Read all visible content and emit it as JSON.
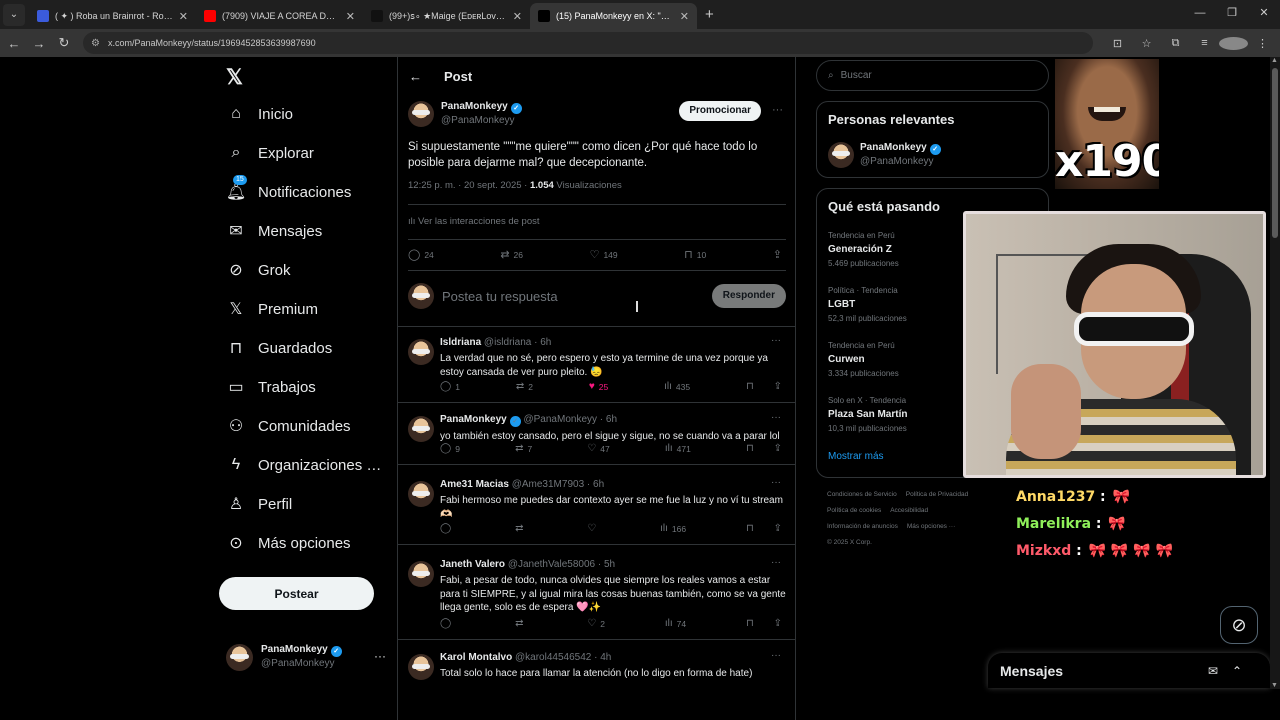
{
  "browser": {
    "tabs": [
      {
        "title": "( ✦ ) Roba un Brainrot - Roblox",
        "favicon": "roblox-icon",
        "color": "#3b5bdb",
        "active": false
      },
      {
        "title": "(7909) VIAJE A COREA DEL SUR",
        "favicon": "youtube-icon",
        "color": "#ff0000",
        "active": false
      },
      {
        "title": "(99+)ꜱ∘ ★Maiɡe (EᴅᴇʀLovᴇs) ♦",
        "favicon": "tiktok-icon",
        "color": "#111111",
        "active": false
      },
      {
        "title": "(15) PanaMonkeyy en X: \"Si sup",
        "favicon": "x-icon",
        "color": "#000000",
        "active": true
      }
    ],
    "url": "x.com/PanaMonkeyy/status/1969452853639987690"
  },
  "sidebar": {
    "logo": "𝕏",
    "items": [
      {
        "label": "Inicio",
        "icon": "home-icon",
        "glyph": "⌂"
      },
      {
        "label": "Explorar",
        "icon": "search-icon",
        "glyph": "⌕"
      },
      {
        "label": "Notificaciones",
        "icon": "bell-icon",
        "glyph": "🔔︎",
        "badge": "15"
      },
      {
        "label": "Mensajes",
        "icon": "mail-icon",
        "glyph": "✉"
      },
      {
        "label": "Grok",
        "icon": "grok-icon",
        "glyph": "⊘"
      },
      {
        "label": "Premium",
        "icon": "x-premium-icon",
        "glyph": "𝕏"
      },
      {
        "label": "Guardados",
        "icon": "bookmark-icon",
        "glyph": "⊓"
      },
      {
        "label": "Trabajos",
        "icon": "briefcase-icon",
        "glyph": "▭"
      },
      {
        "label": "Comunidades",
        "icon": "communities-icon",
        "glyph": "⚇"
      },
      {
        "label": "Organizaciones v...",
        "icon": "lightning-icon",
        "glyph": "ϟ"
      },
      {
        "label": "Perfil",
        "icon": "person-icon",
        "glyph": "♙"
      },
      {
        "label": "Más opciones",
        "icon": "more-circle-icon",
        "glyph": "⊙"
      }
    ],
    "post_button": "Postear",
    "account": {
      "name": "PanaMonkeyy",
      "handle": "@PanaMonkeyy"
    }
  },
  "main": {
    "header_title": "Post",
    "post": {
      "name": "PanaMonkeyy",
      "handle": "@PanaMonkeyy",
      "promote_label": "Promocionar",
      "text": "Si supuestamente \"\"\"me quiere\"\"\" como dicen ¿Por qué hace todo lo posible para dejarme mal? que decepcionante.",
      "time": "12:25 p. m. · 20 sept. 2025 · ",
      "views_count": "1.054",
      "views_label": " Visualizaciones",
      "interactions_link": "Ver las interacciones de post",
      "replies": "24",
      "reposts": "26",
      "likes": "149",
      "bookmarks": "10"
    },
    "composer": {
      "placeholder": "Postea tu respuesta",
      "reply_button": "Responder"
    },
    "replies": [
      {
        "name": "Isldriana",
        "handle": "@isldriana · 6h",
        "text": "La verdad que no sé, pero espero y esto ya termine de una vez porque ya estoy cansada de ver puro pleito. 😓",
        "replies": "1",
        "reposts": "2",
        "likes": "25",
        "views": "435",
        "liked": true,
        "verified": false
      },
      {
        "name": "PanaMonkeyy",
        "handle": "@PanaMonkeyy · 6h",
        "text": "yo también estoy cansado, pero el sigue y sigue, no se cuando va a parar lol",
        "replies": "9",
        "reposts": "7",
        "likes": "47",
        "views": "471",
        "liked": false,
        "verified": true
      },
      {
        "name": "Ame31 Macias",
        "handle": "@Ame31M7903 · 6h",
        "text": "Fabi hermoso me puedes dar contexto ayer se me fue la luz y no ví tu stream 🫶🏻",
        "replies": "",
        "reposts": "",
        "likes": "",
        "views": "166",
        "liked": false,
        "verified": false
      },
      {
        "name": "Janeth Valero",
        "handle": "@JanethVale58006 · 5h",
        "text": "Fabi, a pesar de todo, nunca olvides que siempre los reales vamos a estar para ti SIEMPRE, y al igual mira las cosas buenas también, como se va gente llega gente, solo es de espera 🩷✨",
        "replies": "",
        "reposts": "",
        "likes": "2",
        "views": "74",
        "liked": false,
        "verified": false
      },
      {
        "name": "Karol Montalvo",
        "handle": "@karol44546542 · 4h",
        "text": "Total solo lo hace para llamar la atención (no lo digo en forma de hate)",
        "replies": "",
        "reposts": "",
        "likes": "",
        "views": "",
        "liked": false,
        "verified": false
      }
    ]
  },
  "right": {
    "search_placeholder": "Buscar",
    "relevant_title": "Personas relevantes",
    "relevant": {
      "name": "PanaMonkeyy",
      "handle": "@PanaMonkeyy"
    },
    "trends_title": "Qué está pasando",
    "trends": [
      {
        "context": "Tendencia en Perú",
        "name": "Generación Z",
        "posts": "5.469 publicaciones"
      },
      {
        "context": "Política · Tendencia",
        "name": "LGBT",
        "posts": "52,3 mil publicaciones"
      },
      {
        "context": "Tendencia en Perú",
        "name": "Curwen",
        "posts": "3.334 publicaciones"
      },
      {
        "context": "Solo en X · Tendencia",
        "name": "Plaza San Martín",
        "posts": "10,3 mil publicaciones"
      }
    ],
    "show_more": "Mostrar más",
    "footer": [
      "Condiciones de Servicio",
      "Política de Privacidad",
      "Política de cookies",
      "Accesibilidad",
      "Información de anuncios",
      "Más opciones ···",
      "© 2025 X Corp."
    ]
  },
  "overlay": {
    "multiplier": "x190",
    "chat": [
      {
        "user": "Anna1237",
        "color": "#ffd966",
        "emotes": "🎀"
      },
      {
        "user": "Marelikra",
        "color": "#8fef5a",
        "emotes": "🎀"
      },
      {
        "user": "Mizkxd",
        "color": "#ff5a6a",
        "emotes": "🎀 🎀 🎀 🎀"
      }
    ]
  },
  "messages_drawer": {
    "title": "Mensajes"
  }
}
